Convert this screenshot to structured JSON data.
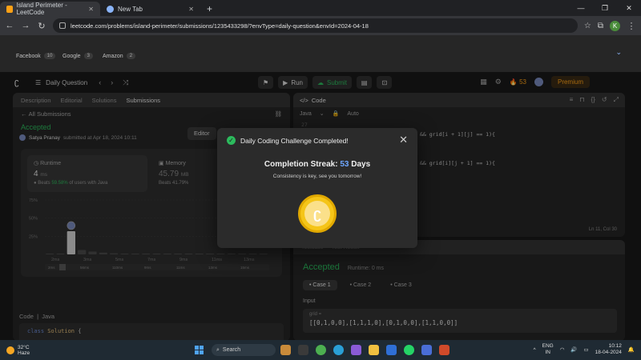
{
  "browser": {
    "tabs": [
      {
        "title": "Island Perimeter - LeetCode"
      },
      {
        "title": "New Tab"
      }
    ],
    "url": "leetcode.com/problems/island-perimeter/submissions/1235433298/?envType=daily-question&envId=2024-04-18",
    "profile_initial": "K"
  },
  "companies": [
    {
      "name": "Facebook",
      "count": "10"
    },
    {
      "name": "Google",
      "count": "3"
    },
    {
      "name": "Amazon",
      "count": "2"
    }
  ],
  "nav": {
    "daily_question": "Daily Question",
    "run": "Run",
    "submit": "Submit",
    "streak": "53",
    "premium": "Premium"
  },
  "left": {
    "tabs": [
      "Description",
      "Editorial",
      "Solutions",
      "Submissions"
    ],
    "back": "All Submissions",
    "status": "Accepted",
    "author": "Satya Pranay",
    "submitted": "submitted at Apr 18, 2024 10:11",
    "editorial_btn": "Editor",
    "runtime": {
      "title": "Runtime",
      "value": "4",
      "unit": "ms",
      "beats_label": "Beats",
      "beats_pct": "59.58%",
      "beats_suffix": "of users with Java"
    },
    "memory": {
      "title": "Memory",
      "value": "45.79",
      "unit": "MB",
      "beats": "Beats 41.79%"
    },
    "code_label": "Code",
    "code_lang": "Java",
    "code_line1_kw": "class",
    "code_line1_cls": "Solution",
    "code_line1_rest": " {"
  },
  "chart_data": {
    "type": "bar",
    "yticks": [
      "25%",
      "50%",
      "75%"
    ],
    "xticks": [
      "2ms",
      "3ms",
      "5ms",
      "7ms",
      "9ms",
      "11ms",
      "13ms"
    ],
    "mini_xticks": [
      "2ms",
      "56ms",
      "110ms",
      "9ms",
      "11ms",
      "13ms",
      "15ms"
    ],
    "values": [
      0.6,
      0.6,
      32,
      6,
      4,
      2.5,
      1.5,
      0.8,
      0.6,
      0.6,
      0.5,
      0.5,
      0.4,
      0.4,
      0.4,
      0.4,
      0.4,
      0.4,
      0.4,
      0.4,
      0.4
    ],
    "highlight_index": 2,
    "ylim": [
      0,
      75
    ]
  },
  "right": {
    "title": "Code",
    "lang": "Java",
    "mode": "Auto",
    "line_no": "27",
    "code_line_a": "&& grid[i + 1][j] == 1){",
    "code_line_b": "&& grid[i][j + 1] == 1){",
    "cursor": "Ln 11, Col 30"
  },
  "test": {
    "header": "Test Result",
    "status": "Accepted",
    "runtime": "Runtime: 0 ms",
    "cases": [
      "Case 1",
      "Case 2",
      "Case 3"
    ],
    "input_label": "Input",
    "input_key": "grid =",
    "input_val": "[[0,1,0,0],[1,1,1,0],[0,1,0,0],[1,1,0,0]]"
  },
  "modal": {
    "title": "Daily Coding Challenge Completed!",
    "streak_label": "Completion Streak:",
    "streak_num": "53",
    "streak_unit": "Days",
    "tagline": "Consistency is key, see you tomorrow!"
  },
  "taskbar": {
    "temp": "32°C",
    "weather": "Haze",
    "search": "Search",
    "lang1": "ENG",
    "lang2": "IN",
    "time": "10:12",
    "date": "18-04-2024"
  }
}
